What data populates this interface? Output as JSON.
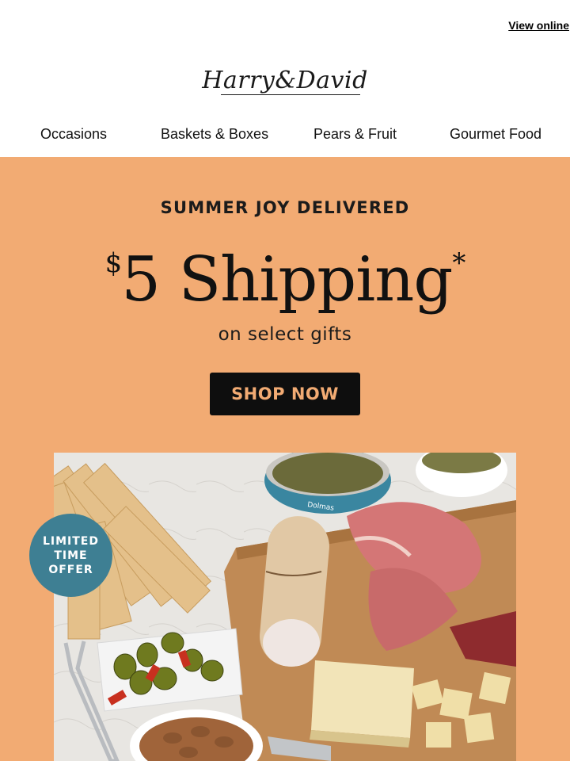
{
  "header": {
    "view_online": "View online",
    "logo_text": "Harry&David"
  },
  "nav": [
    {
      "label": "Occasions"
    },
    {
      "label": "Baskets & Boxes"
    },
    {
      "label": "Pears & Fruit"
    },
    {
      "label": "Gourmet Food"
    }
  ],
  "hero": {
    "kicker": "SUMMER JOY DELIVERED",
    "price_symbol": "$",
    "headline_main": "5 Shipping",
    "headline_mark": "*",
    "subline": "on select gifts",
    "cta": "SHOP NOW",
    "badge_lines": [
      "LIMITED",
      "TIME",
      "OFFER"
    ],
    "tin_label": "Dolmas"
  },
  "colors": {
    "hero_bg": "#f2ab73",
    "cta_bg": "#0e0e0e",
    "badge": "#3e7f93"
  }
}
